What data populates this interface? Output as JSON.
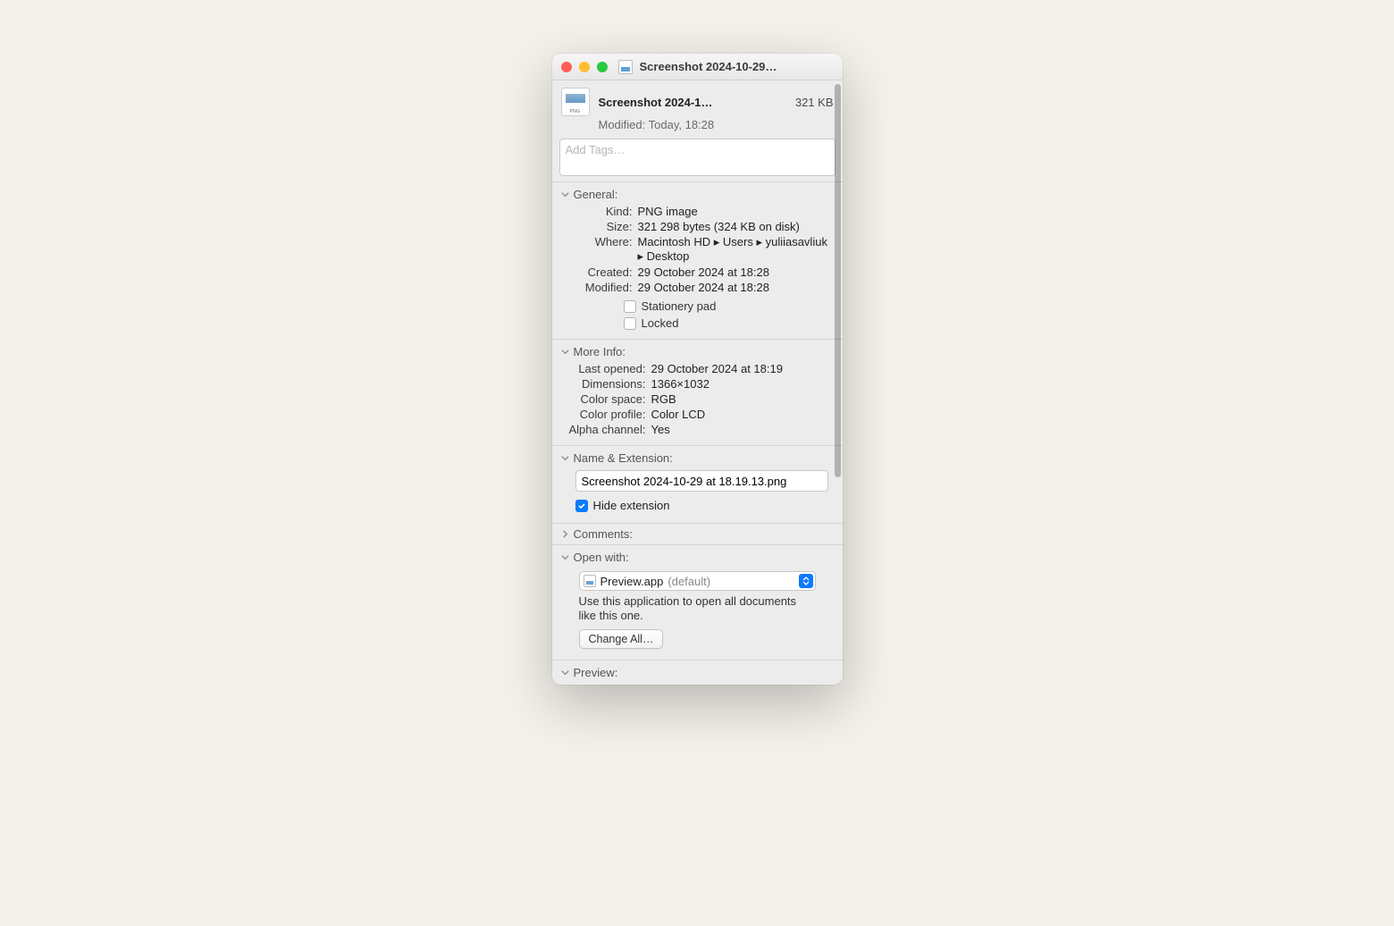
{
  "window": {
    "title": "Screenshot 2024-10-29…"
  },
  "header": {
    "filename_short": "Screenshot 2024-1…",
    "filesize": "321 KB",
    "modified_label": "Modified:",
    "modified_value": "Today, 18:28",
    "tags_placeholder": "Add Tags…"
  },
  "sections": {
    "general": {
      "title": "General:",
      "kind_label": "Kind:",
      "kind_value": "PNG image",
      "size_label": "Size:",
      "size_value": "321 298 bytes (324 KB on disk)",
      "where_label": "Where:",
      "where_value": "Macintosh HD ▸ Users ▸ yuliiasavliuk ▸ Desktop",
      "created_label": "Created:",
      "created_value": "29 October 2024 at 18:28",
      "modified_label": "Modified:",
      "modified_value": "29 October 2024 at 18:28",
      "stationery_label": "Stationery pad",
      "locked_label": "Locked"
    },
    "moreinfo": {
      "title": "More Info:",
      "last_opened_label": "Last opened:",
      "last_opened_value": "29 October 2024 at 18:19",
      "dimensions_label": "Dimensions:",
      "dimensions_value": "1366×1032",
      "colorspace_label": "Color space:",
      "colorspace_value": "RGB",
      "colorprofile_label": "Color profile:",
      "colorprofile_value": "Color LCD",
      "alpha_label": "Alpha channel:",
      "alpha_value": "Yes"
    },
    "name_ext": {
      "title": "Name & Extension:",
      "filename_value": "Screenshot 2024-10-29 at 18.19.13.png",
      "hide_ext_label": "Hide extension"
    },
    "comments": {
      "title": "Comments:"
    },
    "open_with": {
      "title": "Open with:",
      "app_name": "Preview.app",
      "app_suffix": "(default)",
      "hint": "Use this application to open all documents like this one.",
      "change_all_label": "Change All…"
    },
    "preview": {
      "title": "Preview:"
    }
  }
}
